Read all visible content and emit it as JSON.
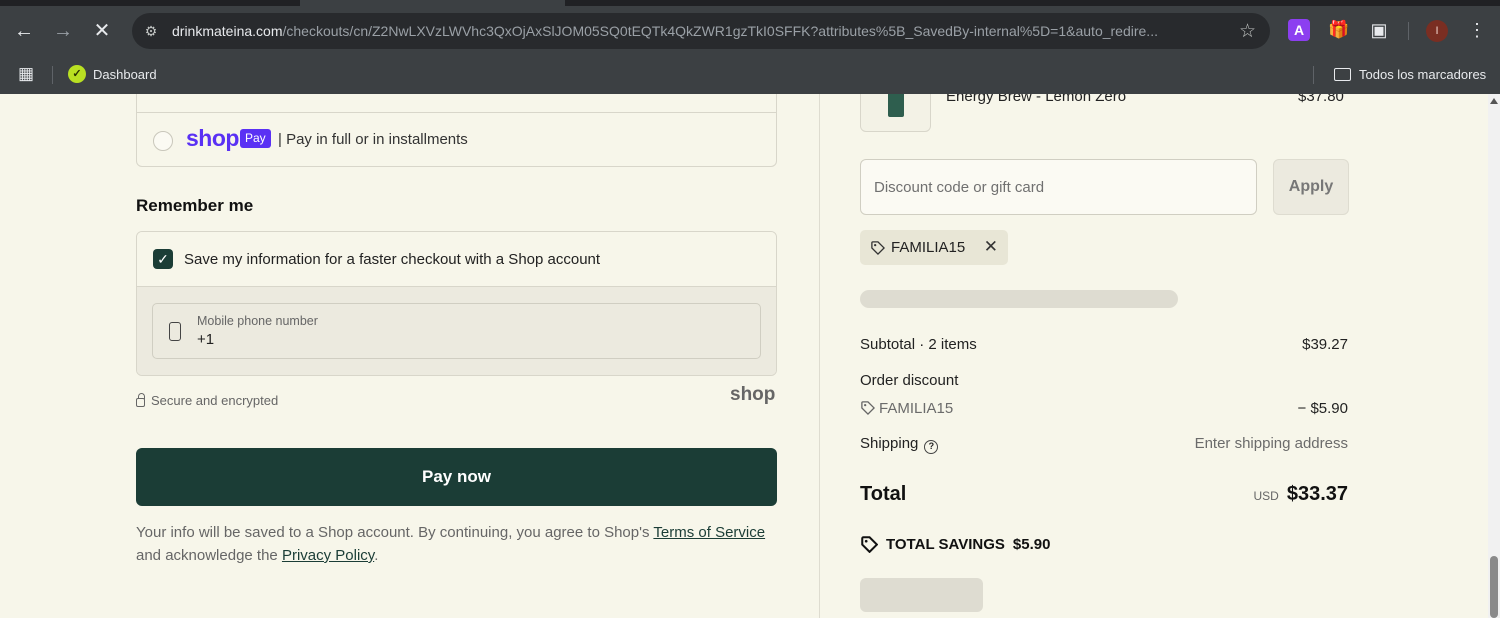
{
  "browser": {
    "url_host": "drinkmateina.com",
    "url_path": "/checkouts/cn/Z2NwLXVzLWVhc3QxOjAxSlJOM05SQ0tEQTk4QkZWR1gzTkI0SFFK?attributes%5B_SavedBy-internal%5D=1&auto_redire...",
    "extension_a_label": "A",
    "avatar_initial": "I",
    "bookmarks": {
      "dashboard": "Dashboard",
      "all_bookmarks": "Todos los marcadores"
    },
    "icons": [
      "back-icon",
      "forward-icon",
      "stop-icon",
      "tune-icon",
      "star-icon",
      "puzzle-icon",
      "menu-icon",
      "apps-icon",
      "folder-icon"
    ]
  },
  "payment": {
    "shop_word": "shop",
    "shop_badge": "Pay",
    "shop_pay_text": "| Pay in full or in installments"
  },
  "remember_me": {
    "heading": "Remember me",
    "save_label": "Save my information for a faster checkout with a Shop account",
    "save_checked": true,
    "phone_label": "Mobile phone number",
    "phone_value": "+1",
    "secure_text": "Secure and encrypted",
    "shop_brand": "shop"
  },
  "pay_now_label": "Pay now",
  "legal": {
    "prefix": "Your info will be saved to a Shop account. By continuing, you agree to Shop's",
    "terms_link": "Terms of Service",
    "middle": "and acknowledge the",
    "privacy_link": "Privacy Policy",
    "suffix": "."
  },
  "summary": {
    "product_name": "Energy Brew - Lemon Zero",
    "product_price": "$37.80",
    "discount_placeholder": "Discount code or gift card",
    "apply_label": "Apply",
    "applied_code": "FAMILIA15",
    "subtotal_label": "Subtotal · 2 items",
    "subtotal_value": "$39.27",
    "order_discount_label": "Order discount",
    "discount_code": "FAMILIA15",
    "discount_value": "− $5.90",
    "shipping_label": "Shipping",
    "shipping_value": "Enter shipping address",
    "total_label": "Total",
    "currency": "USD",
    "total_value": "$33.37",
    "savings_label": "TOTAL SAVINGS",
    "savings_value": "$5.90"
  },
  "colors": {
    "page_bg": "#f7f6ea",
    "accent": "#1b3d36",
    "shop_purple": "#5a31f4",
    "chrome_bg": "#3c4043"
  }
}
